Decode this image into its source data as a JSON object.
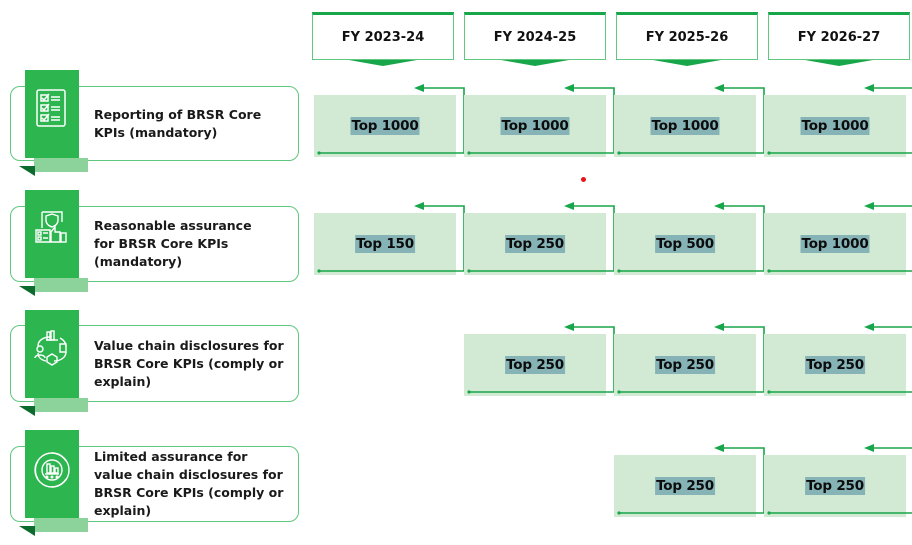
{
  "colors": {
    "accent_green": "#2db54f",
    "light_green_fold": "#8bd39b",
    "dark_green_fold": "#0e6b2e",
    "cell_fill": "#d2e9d3",
    "value_highlight": "#86b4b6",
    "border_green": "#5fc77f",
    "arrow_green": "#18a64a",
    "marker_red": "#e8141c"
  },
  "years": [
    "FY 2023-24",
    "FY 2024-25",
    "FY 2025-26",
    "FY 2026-27"
  ],
  "rows": [
    {
      "label": "Reporting of BRSR Core KPIs (mandatory)",
      "label_lines": [
        "Reporting of BRSR Core",
        "KPIs (mandatory)"
      ],
      "icon": "checklist-icon",
      "values": [
        "Top 1000",
        "Top 1000",
        "Top 1000",
        "Top 1000"
      ]
    },
    {
      "label": "Reasonable assurance for BRSR Core KPIs (mandatory)",
      "label_lines": [
        "Reasonable assurance",
        "for BRSR Core KPIs",
        "(mandatory)"
      ],
      "icon": "assurance-shield-thumbs-up-icon",
      "values": [
        "Top 150",
        "Top 250",
        "Top 500",
        "Top 1000"
      ]
    },
    {
      "label": "Value chain disclosures for BRSR Core KPIs (comply or explain)",
      "label_lines": [
        "Value chain disclosures for",
        "BRSR Core KPIs (comply or",
        "explain)"
      ],
      "icon": "value-chain-cycle-icon",
      "values": [
        null,
        "Top 250",
        "Top 250",
        "Top 250"
      ]
    },
    {
      "label": "Limited assurance for value chain disclosures for BRSR Core KPIs (comply or explain)",
      "label_lines": [
        "Limited assurance for",
        "value chain disclosures for",
        "BRSR Core KPIs (comply or",
        "explain)"
      ],
      "icon": "circular-chart-icon",
      "values": [
        null,
        null,
        "Top 250",
        "Top 250"
      ]
    }
  ]
}
